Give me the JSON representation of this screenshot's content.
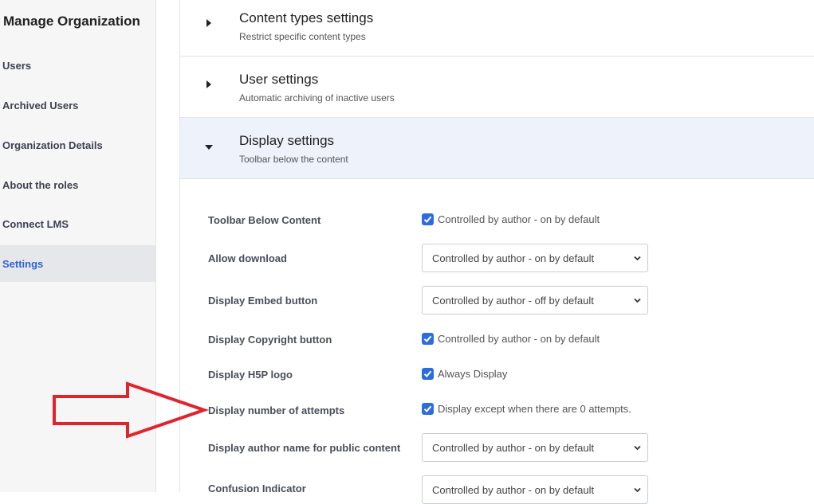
{
  "sidebar": {
    "title": "Manage Organization",
    "items": [
      {
        "label": "Users"
      },
      {
        "label": "Archived Users"
      },
      {
        "label": "Organization Details"
      },
      {
        "label": "About the roles"
      },
      {
        "label": "Connect LMS"
      },
      {
        "label": "Settings",
        "active": true
      }
    ]
  },
  "sections": [
    {
      "title": "Content types settings",
      "subtitle": "Restrict specific content types",
      "state": "collapsed"
    },
    {
      "title": "User settings",
      "subtitle": "Automatic archiving of inactive users",
      "state": "collapsed"
    },
    {
      "title": "Display settings",
      "subtitle": "Toolbar below the content",
      "state": "expanded"
    }
  ],
  "display_settings": [
    {
      "label": "Toolbar Below Content",
      "control": "checkbox",
      "checked": true,
      "value": "Controlled by author - on by default"
    },
    {
      "label": "Allow download",
      "control": "select",
      "value": "Controlled by author - on by default"
    },
    {
      "label": "Display Embed button",
      "control": "select",
      "value": "Controlled by author - off by default"
    },
    {
      "label": "Display Copyright button",
      "control": "checkbox",
      "checked": true,
      "value": "Controlled by author - on by default"
    },
    {
      "label": "Display H5P logo",
      "control": "checkbox",
      "checked": true,
      "value": "Always Display"
    },
    {
      "label": "Display number of attempts",
      "control": "checkbox",
      "checked": true,
      "value": "Display except when there are 0 attempts."
    },
    {
      "label": "Display author name for public content",
      "control": "select",
      "value": "Controlled by author - on by default"
    },
    {
      "label": "Confusion Indicator",
      "control": "select",
      "value": "Controlled by author - on by default"
    }
  ],
  "colors": {
    "accent": "#2b6de0",
    "active_sidebar_text": "#2f63d3",
    "annotation_arrow": "#e0242b"
  },
  "icons": {
    "collapsed": "caret-right-icon",
    "expanded": "caret-down-icon",
    "select": "chevron-down-icon",
    "checkbox": "checkmark-icon",
    "annotation": "red-outline-arrow-icon"
  }
}
